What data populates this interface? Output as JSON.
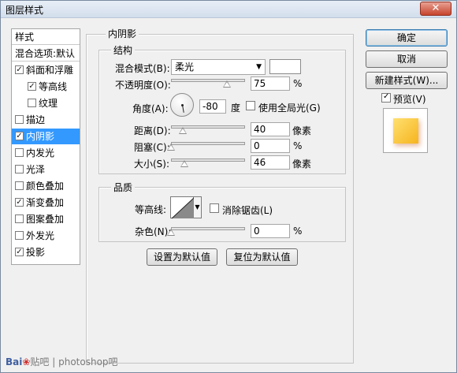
{
  "window": {
    "title": "图层样式",
    "close_glyph": "✕"
  },
  "left_panel": {
    "header": "样式",
    "blend_options": "混合选项:默认",
    "items": [
      {
        "label": "斜面和浮雕",
        "checked": true,
        "sub": false,
        "selected": false
      },
      {
        "label": "等高线",
        "checked": true,
        "sub": true,
        "selected": false
      },
      {
        "label": "纹理",
        "checked": false,
        "sub": true,
        "selected": false
      },
      {
        "label": "描边",
        "checked": false,
        "sub": false,
        "selected": false
      },
      {
        "label": "内阴影",
        "checked": true,
        "sub": false,
        "selected": true
      },
      {
        "label": "内发光",
        "checked": false,
        "sub": false,
        "selected": false
      },
      {
        "label": "光泽",
        "checked": false,
        "sub": false,
        "selected": false
      },
      {
        "label": "颜色叠加",
        "checked": false,
        "sub": false,
        "selected": false
      },
      {
        "label": "渐变叠加",
        "checked": true,
        "sub": false,
        "selected": false
      },
      {
        "label": "图案叠加",
        "checked": false,
        "sub": false,
        "selected": false
      },
      {
        "label": "外发光",
        "checked": false,
        "sub": false,
        "selected": false
      },
      {
        "label": "投影",
        "checked": true,
        "sub": false,
        "selected": false
      }
    ]
  },
  "inner_shadow": {
    "section_title": "内阴影",
    "structure": {
      "title": "结构",
      "blend_mode_label": "混合模式(B):",
      "blend_mode_value": "柔光",
      "swatch_color": "#ffffff",
      "opacity_label": "不透明度(O):",
      "opacity_value": "75",
      "opacity_unit": "%",
      "opacity_fraction": 0.75,
      "angle_label": "角度(A):",
      "angle_value": "-80",
      "angle_unit": "度",
      "angle_degrees": -80,
      "global_light_label": "使用全局光(G)",
      "global_light_checked": false,
      "distance_label": "距离(D):",
      "distance_value": "40",
      "distance_unit": "像素",
      "distance_fraction": 0.16,
      "choke_label": "阻塞(C):",
      "choke_value": "0",
      "choke_unit": "%",
      "choke_fraction": 0.0,
      "size_label": "大小(S):",
      "size_value": "46",
      "size_unit": "像素",
      "size_fraction": 0.18
    },
    "quality": {
      "title": "品质",
      "contour_label": "等高线:",
      "anti_alias_label": "消除锯齿(L)",
      "anti_alias_checked": false,
      "noise_label": "杂色(N):",
      "noise_value": "0",
      "noise_unit": "%",
      "noise_fraction": 0.0
    },
    "set_default_label": "设置为默认值",
    "reset_default_label": "复位为默认值"
  },
  "right_panel": {
    "ok_label": "确定",
    "cancel_label": "取消",
    "new_style_label": "新建样式(W)...",
    "preview_label": "预览(V)",
    "preview_checked": true
  },
  "watermark": {
    "logo": "Bai",
    "text": "贴吧 | photoshop吧"
  },
  "colors": {
    "selection": "#3399ff",
    "accent": "#3c7fb1"
  }
}
